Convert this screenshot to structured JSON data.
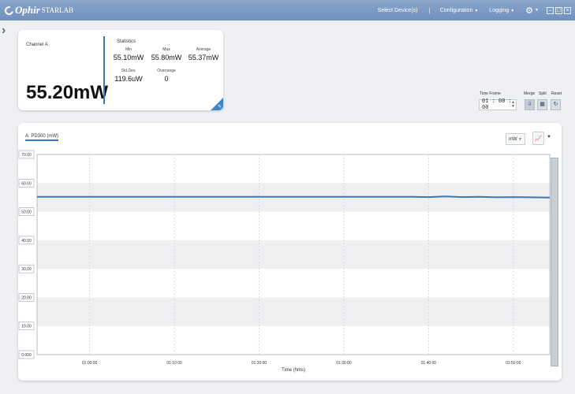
{
  "app": {
    "logo_text": "Ophir",
    "logo_sub": "STARLAB"
  },
  "menu": {
    "select_devices": "Select Device(s)",
    "separator": "|",
    "configuration": "Configuration",
    "logging": "Logging"
  },
  "window_buttons": [
    "–",
    "□",
    "×"
  ],
  "channel": {
    "name": "Channel A",
    "value": "55.20mW",
    "stats_title": "Statistics",
    "stats": [
      {
        "label": "Min",
        "value": "55.10mW"
      },
      {
        "label": "Max",
        "value": "55.80mW"
      },
      {
        "label": "Average",
        "value": "55.37mW"
      },
      {
        "label": "Std.Dev.",
        "value": "119.6uW"
      },
      {
        "label": "Overrange",
        "value": "0"
      }
    ]
  },
  "controls": {
    "time_frame_label": "Time Frame",
    "time_frame_value": "01 : 00 : 00",
    "merge_label": "Merge",
    "split_label": "Split",
    "reset_label": "Reset"
  },
  "chart_panel": {
    "series_tab": "A: PD300 (mW)",
    "unit": "mW"
  },
  "chart_data": {
    "type": "line",
    "title": "",
    "xlabel": "Time (hms)",
    "ylabel": "",
    "y_ticks": [
      "70.00",
      "60.00",
      "50.00",
      "40.00",
      "30.00",
      "20.00",
      "10.00",
      "0.000"
    ],
    "y_tick_values": [
      70,
      60,
      50,
      40,
      30,
      20,
      10,
      0
    ],
    "x_ticks": [
      "01:00:00",
      "01:10:00",
      "01:20:00",
      "01:30:00",
      "01:40:00",
      "01:50:00"
    ],
    "x_tick_values": [
      60,
      70,
      80,
      90,
      100,
      110
    ],
    "xlim": [
      53.8,
      114.3
    ],
    "ylim": [
      0,
      70
    ],
    "series": [
      {
        "color": "#3b79b4",
        "x": [
          53.8,
          60,
          70,
          80,
          90,
          98,
          100,
          102,
          104,
          106,
          108,
          110,
          112,
          114.3
        ],
        "y": [
          55.2,
          55.2,
          55.2,
          55.2,
          55.2,
          55.2,
          55.1,
          55.3,
          55.1,
          55.2,
          55.0,
          55.1,
          55.0,
          54.9
        ]
      }
    ]
  }
}
